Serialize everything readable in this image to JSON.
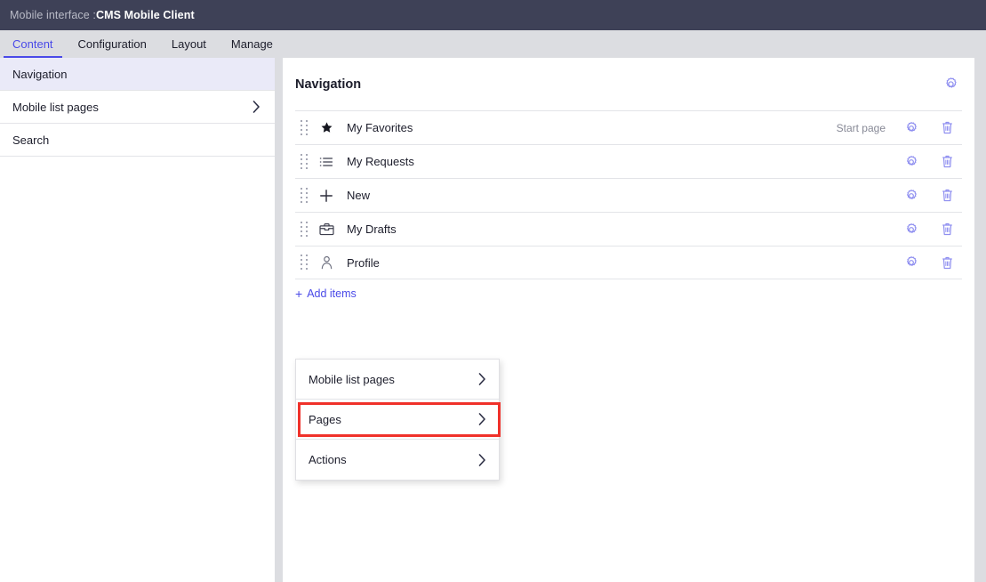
{
  "titlebar": {
    "prefix": "Mobile interface :",
    "name": "CMS Mobile Client"
  },
  "tabs": [
    {
      "label": "Content",
      "active": true
    },
    {
      "label": "Configuration",
      "active": false
    },
    {
      "label": "Layout",
      "active": false
    },
    {
      "label": "Manage",
      "active": false
    }
  ],
  "sidebar": {
    "items": [
      {
        "label": "Navigation",
        "selected": true,
        "chevron": false
      },
      {
        "label": "Mobile list pages",
        "selected": false,
        "chevron": true
      },
      {
        "label": "Search",
        "selected": false,
        "chevron": false
      }
    ]
  },
  "panel": {
    "title": "Navigation",
    "settings_icon": "gear-icon",
    "rows": [
      {
        "icon": "star-icon",
        "label": "My Favorites",
        "tag": "Start page"
      },
      {
        "icon": "list-icon",
        "label": "My Requests",
        "tag": ""
      },
      {
        "icon": "plus-icon",
        "label": "New",
        "tag": ""
      },
      {
        "icon": "briefcase-icon",
        "label": "My Drafts",
        "tag": ""
      },
      {
        "icon": "person-icon",
        "label": "Profile",
        "tag": ""
      }
    ],
    "row_action_icons": [
      "gear-icon",
      "trash-icon"
    ],
    "add_items": {
      "plus": "+",
      "label": "Add items"
    }
  },
  "menu": {
    "items": [
      {
        "label": "Mobile list pages",
        "highlighted": false
      },
      {
        "label": "Pages",
        "highlighted": true
      },
      {
        "label": "Actions",
        "highlighted": false
      }
    ]
  },
  "colors": {
    "titlebar_bg": "#3e4157",
    "tabbar_bg": "#dcdde1",
    "accent_blue": "#4a4ae8",
    "icon_blue": "#8f8ff0",
    "selected_sidebar": "#eaeaf8",
    "highlight_red": "#f0312a",
    "body_bg": "#dcdde1",
    "text_dark": "#1c1d2b"
  }
}
